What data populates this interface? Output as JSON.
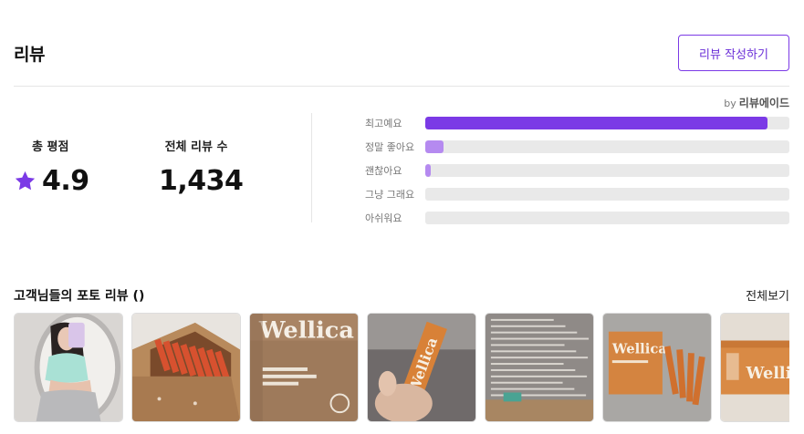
{
  "header": {
    "title": "리뷰",
    "write_button": "리뷰 작성하기"
  },
  "byline": {
    "by": "by",
    "brand": "리뷰에이드"
  },
  "summary": {
    "avg_label": "총 평점",
    "avg_value": "4.9",
    "total_label": "전체 리뷰 수",
    "total_value": "1,434"
  },
  "distribution": [
    {
      "label": "최고예요",
      "fraction": 0.94,
      "color": "#7b3ae6"
    },
    {
      "label": "정말 좋아요",
      "fraction": 0.05,
      "color": "#b58af0"
    },
    {
      "label": "괜찮아요",
      "fraction": 0.015,
      "color": "#b58af0"
    },
    {
      "label": "그냥 그래요",
      "fraction": 0,
      "color": "#b58af0"
    },
    {
      "label": "아쉬워요",
      "fraction": 0,
      "color": "#b58af0"
    }
  ],
  "photos": {
    "title": "고객님들의 포토 리뷰 ()",
    "see_all": "전체보기",
    "items": [
      {
        "kind": "mirror-selfie"
      },
      {
        "kind": "open-box-orange-sticks"
      },
      {
        "kind": "package-front",
        "logo": "Wellica"
      },
      {
        "kind": "hand-holding-stick",
        "logo": "Wellica"
      },
      {
        "kind": "package-back-text"
      },
      {
        "kind": "box-with-sticks",
        "logo": "Wellica"
      },
      {
        "kind": "orange-stick-closeup",
        "logo": "Wellica"
      }
    ]
  },
  "colors": {
    "accent": "#7b3ae6",
    "accent_light": "#b58af0",
    "track": "#e9e9e9"
  }
}
